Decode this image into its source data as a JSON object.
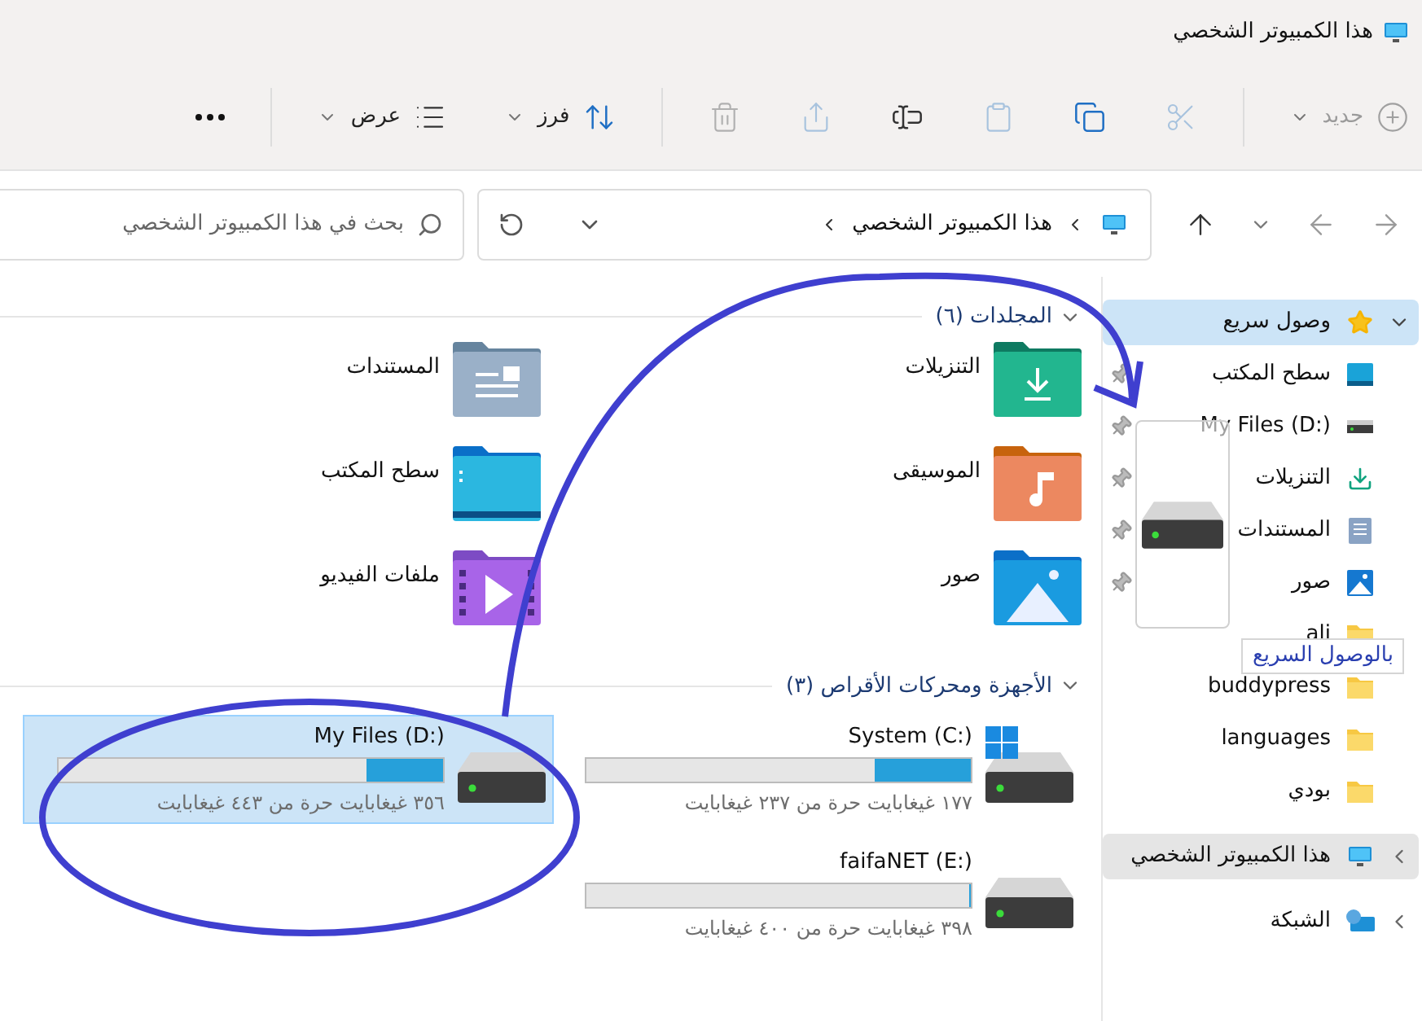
{
  "window": {
    "title": "هذا الكمبيوتر الشخصي"
  },
  "toolbar": {
    "items": [
      {
        "kind": "new",
        "label": "جديد",
        "disabled": true
      },
      {
        "kind": "cut",
        "disabled": true
      },
      {
        "kind": "copy",
        "disabled": false
      },
      {
        "kind": "paste",
        "disabled": true
      },
      {
        "kind": "rename",
        "disabled": false
      },
      {
        "kind": "share",
        "disabled": true
      },
      {
        "kind": "delete",
        "disabled": true
      },
      {
        "kind": "sort",
        "label": "فرز",
        "disabled": false
      },
      {
        "kind": "view",
        "label": "عرض",
        "disabled": false
      },
      {
        "kind": "more",
        "disabled": false
      }
    ]
  },
  "navigation": [
    {
      "kind": "back",
      "disabled": true
    },
    {
      "kind": "forward",
      "disabled": true
    },
    {
      "kind": "recent",
      "disabled": false
    },
    {
      "kind": "up",
      "disabled": false
    }
  ],
  "address": {
    "path": [
      "هذا الكمبيوتر الشخصي"
    ]
  },
  "search": {
    "placeholder": "بحث في هذا الكمبيوتر الشخصي"
  },
  "sidebar": {
    "items": [
      {
        "kind": "quick",
        "label": "وصول سريع",
        "selected": true,
        "expanded": true,
        "children": [
          {
            "kind": "desktop",
            "label": "سطح المكتب",
            "pinned": true
          },
          {
            "kind": "drive",
            "label": "My Files (D:)",
            "pinned": true
          },
          {
            "kind": "downloads",
            "label": "التنزيلات",
            "pinned": true
          },
          {
            "kind": "documents",
            "label": "المستندات",
            "pinned": true
          },
          {
            "kind": "pictures",
            "label": "صور",
            "pinned": true
          },
          {
            "kind": "folder",
            "label": "ali",
            "pinned": false
          },
          {
            "kind": "folder",
            "label": "buddypress",
            "pinned": false
          },
          {
            "kind": "folder",
            "label": "languages",
            "pinned": false
          },
          {
            "kind": "folder",
            "label": "بودي",
            "pinned": false
          }
        ]
      },
      {
        "kind": "pc",
        "label": "هذا الكمبيوتر الشخصي",
        "selected": false,
        "hovered": true,
        "expanded": false
      },
      {
        "kind": "network",
        "label": "الشبكة",
        "selected": false,
        "hovered": false,
        "expanded": false
      }
    ]
  },
  "folders": {
    "title": "المجلدات (٦)",
    "expanded": true,
    "items": [
      {
        "kind": "downloads",
        "name": "التنزيلات"
      },
      {
        "kind": "documents",
        "name": "المستندات"
      },
      {
        "kind": "music",
        "name": "الموسيقى"
      },
      {
        "kind": "desktop",
        "name": "سطح المكتب"
      },
      {
        "kind": "pictures",
        "name": "صور"
      },
      {
        "kind": "videos",
        "name": "ملفات الفيديو"
      }
    ]
  },
  "drives": {
    "title": "الأجهزة ومحركات الأقراص (٣)",
    "expanded": true,
    "items": [
      {
        "kind": "system",
        "name": "System (C:)",
        "level": 0.25,
        "free": "١٧٧ غيغابايت حرة من ٢٣٧ غيغابايت",
        "selected": false
      },
      {
        "kind": "drive",
        "name": "My Files (D:)",
        "level": 0.2,
        "free": "٣٥٦ غيغابايت حرة من ٤٤٣ غيغابايت",
        "selected": true
      },
      {
        "kind": "drive",
        "name": "faifaNET (E:)",
        "level": 0.005,
        "free": "٣٩٨ غيغابايت حرة من ٤٠٠ غيغابايت",
        "selected": false
      }
    ]
  },
  "drag": {
    "tooltip": "بالوصول السريع"
  }
}
